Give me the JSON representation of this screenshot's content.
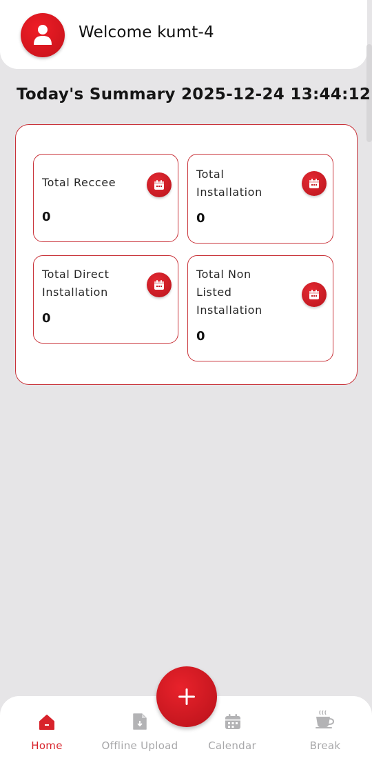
{
  "header": {
    "welcome_text": "Welcome kumt-4",
    "avatar_icon": "user-icon"
  },
  "summary": {
    "title": "Today's Summary 2025-12-24 13:44:12",
    "stats": [
      {
        "label": "Total Reccee",
        "value": "0",
        "icon": "calendar-icon"
      },
      {
        "label": "Total Installation",
        "value": "0",
        "icon": "calendar-icon"
      },
      {
        "label": "Total Direct Installation",
        "value": "0",
        "icon": "calendar-icon"
      },
      {
        "label": "Total Non Listed Installation",
        "value": "0",
        "icon": "calendar-icon"
      }
    ]
  },
  "fab": {
    "icon": "plus-icon"
  },
  "nav": {
    "items": [
      {
        "label": "Home",
        "icon": "home-icon",
        "active": true
      },
      {
        "label": "Offline Upload",
        "icon": "file-upload-icon",
        "active": false
      },
      {
        "label": "Calendar",
        "icon": "calendar-icon",
        "active": false
      },
      {
        "label": "Break",
        "icon": "coffee-cup-icon",
        "active": false
      }
    ]
  },
  "colors": {
    "accent": "#d8232b",
    "background": "#e6e5e7",
    "card_border": "#c9333a",
    "inactive_nav": "#a7a7a9"
  }
}
